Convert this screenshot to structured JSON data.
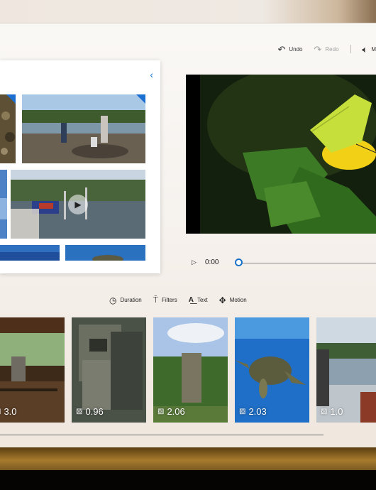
{
  "toolbar": {
    "undo": "Undo",
    "redo": "Redo",
    "music_partial": "M"
  },
  "preview": {
    "time": "0:00"
  },
  "storyboard_tools": [
    {
      "label": "Duration",
      "icon": "clock-icon"
    },
    {
      "label": "Filters",
      "icon": "filters-icon"
    },
    {
      "label": "Text",
      "icon": "text-icon"
    },
    {
      "label": "Motion",
      "icon": "motion-icon"
    }
  ],
  "storyboard": [
    {
      "duration": "3.0"
    },
    {
      "duration": "0.96"
    },
    {
      "duration": "2.06"
    },
    {
      "duration": "2.03"
    },
    {
      "duration": "1.0"
    }
  ],
  "colors": {
    "accent": "#1a73c8",
    "corner_badge": "#1a6fd1"
  }
}
